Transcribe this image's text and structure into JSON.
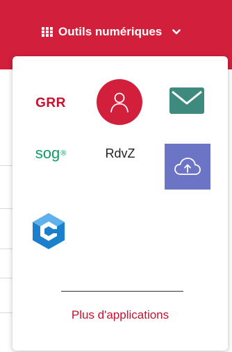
{
  "header": {
    "menu_label": "Outils numériques",
    "grid_icon": "apps-grid-icon",
    "chevron_icon": "chevron-down-icon",
    "background_color": "#d21f3c"
  },
  "apps": {
    "grr_label": "GRR",
    "profile_icon": "user-profile-icon",
    "mail_icon": "envelope-icon",
    "sogo_label": "sog",
    "sogo_mark": "®",
    "rdvz_label": "RdvZ",
    "cloud_icon": "cloud-upload-icon",
    "cube_icon": "e-cube-logo-icon"
  },
  "footer": {
    "more_label": "Plus d'applications"
  },
  "colors": {
    "accent_red": "#d21f3c",
    "mail_teal": "#3f8a7e",
    "sogo_green": "#0d9c64",
    "cloud_purple": "#6c74c6",
    "cube_blue": "#1c7fcc"
  }
}
